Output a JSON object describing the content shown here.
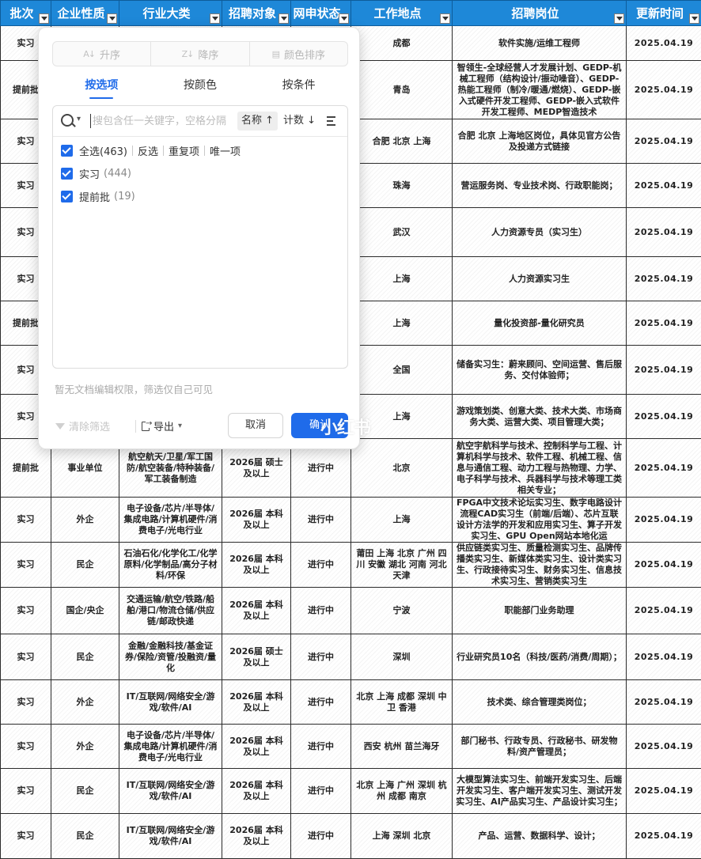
{
  "headers": [
    "批次",
    "企业性质",
    "行业大类",
    "招聘对象",
    "网申状态",
    "工作地点",
    "招聘岗位",
    "更新时间"
  ],
  "rows": [
    {
      "batch": "实习",
      "type": "",
      "industry": "",
      "target": "",
      "status": "",
      "location": "成都",
      "position": "软件实施/运维工程师",
      "updated": "2025.04.19"
    },
    {
      "batch": "提前批",
      "type": "",
      "industry": "",
      "target": "",
      "status": "",
      "location": "青岛",
      "position": "智领生-全球经营人才发展计划、GEDP-机械工程师（结构设计/振动噪音）、GEDP-热能工程师（制冷/暖通/燃烧）、GEDP-嵌入式硬件开发工程师、GEDP-嵌入式软件开发工程师、MEDP智造技术",
      "updated": "2025.04.19"
    },
    {
      "batch": "实习",
      "type": "",
      "industry": "",
      "target": "",
      "status": "",
      "location": "合肥 北京 上海",
      "position": "合肥 北京 上海地区岗位，具体见官方公告及投递方式链接",
      "updated": "2025.04.19"
    },
    {
      "batch": "实习",
      "type": "",
      "industry": "",
      "target": "",
      "status": "",
      "location": "珠海",
      "position": "营运服务岗、专业技术岗、行政职能岗；",
      "updated": "2025.04.19"
    },
    {
      "batch": "实习",
      "type": "",
      "industry": "",
      "target": "",
      "status": "",
      "location": "武汉",
      "position": "人力资源专员（实习生）",
      "updated": "2025.04.19"
    },
    {
      "batch": "实习",
      "type": "",
      "industry": "",
      "target": "",
      "status": "",
      "location": "上海",
      "position": "人力资源实习生",
      "updated": "2025.04.19"
    },
    {
      "batch": "提前批",
      "type": "",
      "industry": "",
      "target": "",
      "status": "",
      "location": "上海",
      "position": "量化投资部-量化研究员",
      "updated": "2025.04.19"
    },
    {
      "batch": "实习",
      "type": "",
      "industry": "",
      "target": "",
      "status": "",
      "location": "全国",
      "position": "储备实习生：蔚来顾问、空间运营、售后服务、交付体验师；",
      "updated": "2025.04.19"
    },
    {
      "batch": "实习",
      "type": "",
      "industry": "",
      "target": "",
      "status": "",
      "location": "上海",
      "position": "游戏策划类、创意大类、技术大类、市场商务大类、运营大类、项目管理大类；",
      "updated": "2025.04.19"
    },
    {
      "batch": "提前批",
      "type": "事业单位",
      "industry": "航空航天/卫星/军工国防/航空装备/特种装备/军工装备制造",
      "target": "2026届 硕士及以上",
      "status": "进行中",
      "location": "北京",
      "position": "航空宇航科学与技术、控制科学与工程、计算机科学与技术、软件工程、机械工程、信息与通信工程、动力工程与热物理、力学、电子科学与技术、兵器科学与技术等理工类相关专业；",
      "updated": "2025.04.19"
    },
    {
      "batch": "实习",
      "type": "外企",
      "industry": "电子设备/芯片/半导体/集成电路/计算机硬件/消费电子/光电行业",
      "target": "2026届 本科及以上",
      "status": "进行中",
      "location": "上海",
      "position": "FPGA中文技术论坛实习生、数字电路设计流程CAD实习生（前端/后端）、芯片互联设计方法学的开发和应用实习生、算子开发实习生、GPU Open网站本地化运",
      "updated": "2025.04.19"
    },
    {
      "batch": "实习",
      "type": "民企",
      "industry": "石油石化/化学化工/化学原料/化学制品/高分子材料/环保",
      "target": "2026届 本科及以上",
      "status": "进行中",
      "location": "莆田 上海 北京 广州 四川 安徽 湖北 河南 河北 天津",
      "position": "供应链类实习生、质量检测实习生、品牌传播类实习生、新媒体类实习生、设计类实习生、行政接待实习生、财务实习生、信息技术实习生、营销类实习生",
      "updated": "2025.04.19"
    },
    {
      "batch": "实习",
      "type": "国企/央企",
      "industry": "交通运输/航空/铁路/船舶/港口/物流仓储/供应链/邮政快递",
      "target": "2026届 本科及以上",
      "status": "进行中",
      "location": "宁波",
      "position": "职能部门业务助理",
      "updated": "2025.04.19"
    },
    {
      "batch": "实习",
      "type": "民企",
      "industry": "金融/金融科技/基金证券/保险/资管/投融资/量化",
      "target": "2026届 硕士及以上",
      "status": "进行中",
      "location": "深圳",
      "position": "行业研究员10名（科技/医药/消费/周期）；",
      "updated": "2025.04.19"
    },
    {
      "batch": "实习",
      "type": "外企",
      "industry": "IT/互联网/网络安全/游戏/软件/AI",
      "target": "2026届 本科及以上",
      "status": "进行中",
      "location": "北京 上海 成都 深圳 中卫 香港",
      "position": "技术类、综合管理类岗位；",
      "updated": "2025.04.19"
    },
    {
      "batch": "实习",
      "type": "外企",
      "industry": "电子设备/芯片/半导体/集成电路/计算机硬件/消费电子/光电行业",
      "target": "2026届 本科及以上",
      "status": "进行中",
      "location": "西安 杭州 苗兰海牙",
      "position": "部门秘书、行政专员、行政秘书、研发物料/资产管理员；",
      "updated": "2025.04.19"
    },
    {
      "batch": "实习",
      "type": "民企",
      "industry": "IT/互联网/网络安全/游戏/软件/AI",
      "target": "2026届 本科及以上",
      "status": "进行中",
      "location": "北京 上海 广州 深圳 杭州 成都 南京",
      "position": "大模型算法实习生、前端开发实习生、后端开发实习生、客户端开发实习生、测试开发实习生、AI产品实习生、产品设计实习生；",
      "updated": "2025.04.19"
    },
    {
      "batch": "实习",
      "type": "民企",
      "industry": "IT/互联网/网络安全/游戏/软件/AI",
      "target": "2026届 本科及以上",
      "status": "进行中",
      "location": "上海 深圳 北京",
      "position": "产品、运营、数据科学、设计；",
      "updated": "2025.04.19"
    }
  ],
  "filter_popup": {
    "sort": {
      "asc": "升序",
      "desc": "降序",
      "color": "颜色排序"
    },
    "tabs": [
      "按选项",
      "按颜色",
      "按条件"
    ],
    "search_placeholder": "搜包含任一关键字，空格分隔",
    "sort_name": "名称 ↑",
    "sort_count": "计数 ↓",
    "quick": {
      "select_all": "全选(463)",
      "invert": "反选",
      "duplicates": "重复项",
      "unique": "唯一项"
    },
    "options": [
      {
        "label": "实习",
        "count": "(444)"
      },
      {
        "label": "提前批",
        "count": "(19)"
      }
    ],
    "notice": "暂无文档编辑权限，筛选仅自己可见",
    "clear": "清除筛选",
    "export": "导出",
    "cancel": "取消",
    "confirm": "确认"
  },
  "watermark": "小红书"
}
